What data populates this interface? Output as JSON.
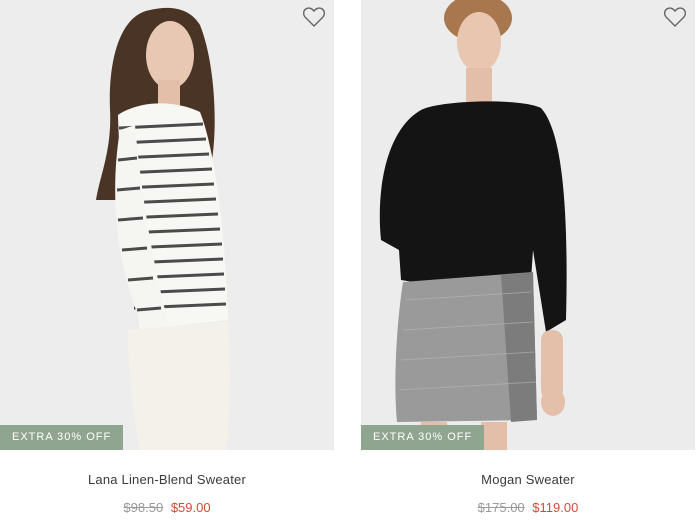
{
  "products": [
    {
      "name": "Lana Linen-Blend Sweater",
      "badge": "EXTRA 30% OFF",
      "original_price": "$98.50",
      "sale_price": "$59.00",
      "wishlist_icon": "heart-outline-icon"
    },
    {
      "name": "Mogan Sweater",
      "badge": "EXTRA 30% OFF",
      "original_price": "$175.00",
      "sale_price": "$119.00",
      "wishlist_icon": "heart-outline-icon"
    }
  ],
  "colors": {
    "badge_bg": "#8fa58f",
    "sale_price": "#d04a3a",
    "original_price": "#9a9a9a",
    "image_bg": "#ececec"
  }
}
